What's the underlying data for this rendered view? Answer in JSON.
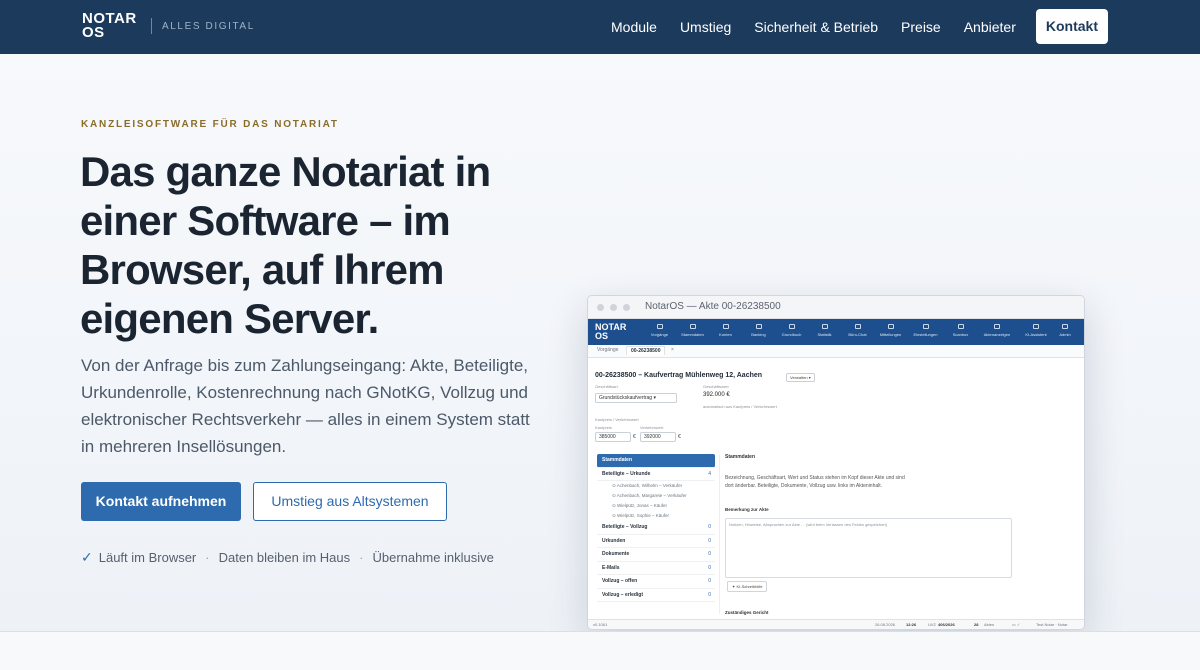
{
  "nav": {
    "logo_line1": "NOTAR",
    "logo_line2": "OS",
    "tagline": "ALLES DIGITAL",
    "links": [
      "Module",
      "Umstieg",
      "Sicherheit & Betrieb",
      "Preise",
      "Anbieter"
    ],
    "cta": "Kontakt"
  },
  "hero": {
    "eyebrow": "KANZLEISOFTWARE FÜR DAS NOTARIAT",
    "title": "Das ganze Notariat in einer Software – im Browser, auf Ihrem eigenen Server.",
    "lead": "Von der Anfrage bis zum Zahlungseingang: Akte, Beteiligte, Urkundenrolle, Kostenrechnung nach GNotKG, Vollzug und elektronischer Rechtsverkehr — alles in einem System statt in mehreren Insellösungen.",
    "primary_button": "Kontakt aufnehmen",
    "secondary_button": "Umstieg aus Altsystemen",
    "checks": [
      "Läuft im Browser",
      "Daten bleiben im Haus",
      "Übernahme inklusive"
    ]
  },
  "app": {
    "window_title": "NotarOS — Akte 00-26238500",
    "logo_line1": "NOTAR",
    "logo_line2": "OS",
    "nav_items": [
      "Vorgänge",
      "Stammdaten",
      "Konten",
      "Banking",
      "Grundbuch",
      "Statistik",
      "Büro-Chat",
      "Mitteilungen",
      "Einstellungen",
      "Scanbox",
      "Aktenanzeigen",
      "KI-Assistent",
      "Admin"
    ],
    "tabs": [
      "Vorgänge",
      "00-26238500"
    ],
    "akte_title": "00-26238500 – Kaufvertrag Mühlenweg 12, Aachen",
    "verwalten": "Verwalten",
    "geschaeftsart_label": "Geschäftsart",
    "geschaeftsart_value": "Grundstückskaufvertrag",
    "geschaeftswert_label": "Geschäftswert",
    "geschaeftswert_value": "392.000 €",
    "geschaeftswert_hint": "automatisch aus Kaufpreis / Verkehrswert",
    "kaufpreis_group": "Kaufpreis / Verkehrswert",
    "kaufpreis_label": "Kaufpreis",
    "kaufpreis_value": "385000",
    "verkehrswert_label": "Verkehrswert",
    "verkehrswert_value": "392000",
    "sidebar": [
      {
        "label": "Stammdaten",
        "count": ""
      },
      {
        "label": "Beteiligte – Urkunde",
        "count": "4"
      },
      {
        "label": "Beteiligte – Vollzug",
        "count": "0"
      },
      {
        "label": "Urkunden",
        "count": "0"
      },
      {
        "label": "Dokumente",
        "count": "0"
      },
      {
        "label": "E-Mails",
        "count": "0"
      },
      {
        "label": "Vollzug – offen",
        "count": "0"
      },
      {
        "label": "Vollzug – erledigt",
        "count": "0"
      }
    ],
    "beteiligte": [
      "Achenbach, Wilhelm – Verkäufer",
      "Achenbach, Margarete – Verkäufer",
      "Wielpütz, Jonas – Käufer",
      "Wielpütz, Sophie – Käufer"
    ],
    "content_heading": "Stammdaten",
    "content_text1": "Bezeichnung, Geschäftsart, Wert und Status stehen im Kopf dieser Akte und sind",
    "content_text2": "dort änderbar. Beteiligte, Dokumente, Vollzug usw. links im Akteninhalt.",
    "bemerkung_label": "Bemerkung zur Akte",
    "bemerkung_placeholder": "Notizen, Hinweise, Absprachen zur Akte … (wird beim Verlassen des Feldes gespeichert)",
    "ki_button": "✦ KI-Schreibhilfe",
    "gericht_label": "Zuständiges Gericht",
    "status_version": "v0.1061",
    "status_date": "26.08.2026",
    "status_time": "12:26",
    "status_uvz_label": "UVZ",
    "status_uvz_value": "406/2026",
    "status_akten_value": "28",
    "status_akten_label": "Akten",
    "status_user": "Test Notar · Notar"
  },
  "colors": {
    "nav_bg": "#1b3a5c",
    "accent": "#2d6bae",
    "eyebrow": "#8a6d2a"
  }
}
